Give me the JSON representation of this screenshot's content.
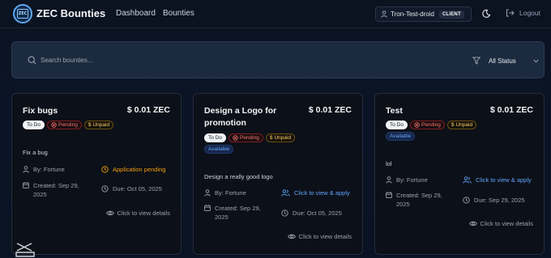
{
  "nav": {
    "logo_text": "ZEC",
    "brand": "ZEC Bounties",
    "links": [
      "Dashboard",
      "Bounties"
    ],
    "user": "Tron-Test-droid",
    "role": "CLIENT",
    "logout": "Logout"
  },
  "search": {
    "placeholder": "Search bounties...",
    "status_filter": "All Status"
  },
  "cards": [
    {
      "title": "Fix bugs",
      "price": "$ 0.01 ZEC",
      "badges": [
        "To Do",
        "Pending",
        "Unpaid"
      ],
      "description": "Fix a bug",
      "by": "By: Fortune",
      "action": "Application pending",
      "created": "Created: Sep 29, 2025",
      "due": "Due: Oct 05, 2025",
      "view": "Click to view details"
    },
    {
      "title": "Design a Logo for promotion",
      "price": "$ 0.01 ZEC",
      "badges": [
        "To Do",
        "Pending",
        "Unpaid",
        "Available"
      ],
      "description": "Design a really good logo",
      "by": "By: Fortune",
      "action": "Click to view & apply",
      "created": "Created: Sep 29, 2025",
      "due": "Due: Oct 05, 2025",
      "view": "Click to view details"
    },
    {
      "title": "Test",
      "price": "$ 0.01 ZEC",
      "badges": [
        "To Do",
        "Pending",
        "Unpaid",
        "Available"
      ],
      "description": "lol",
      "by": "By: Fortune",
      "action": "Click to view & apply",
      "created": "Created: Sep 29, 2025",
      "due": "Due: Sep 29, 2025",
      "view": "Click to view details"
    }
  ],
  "colors": {
    "accent_blue": "#60a5fa",
    "pending_red": "#f87171",
    "unpaid_gold": "#f3c96b",
    "application_orange": "#f59e0b"
  }
}
